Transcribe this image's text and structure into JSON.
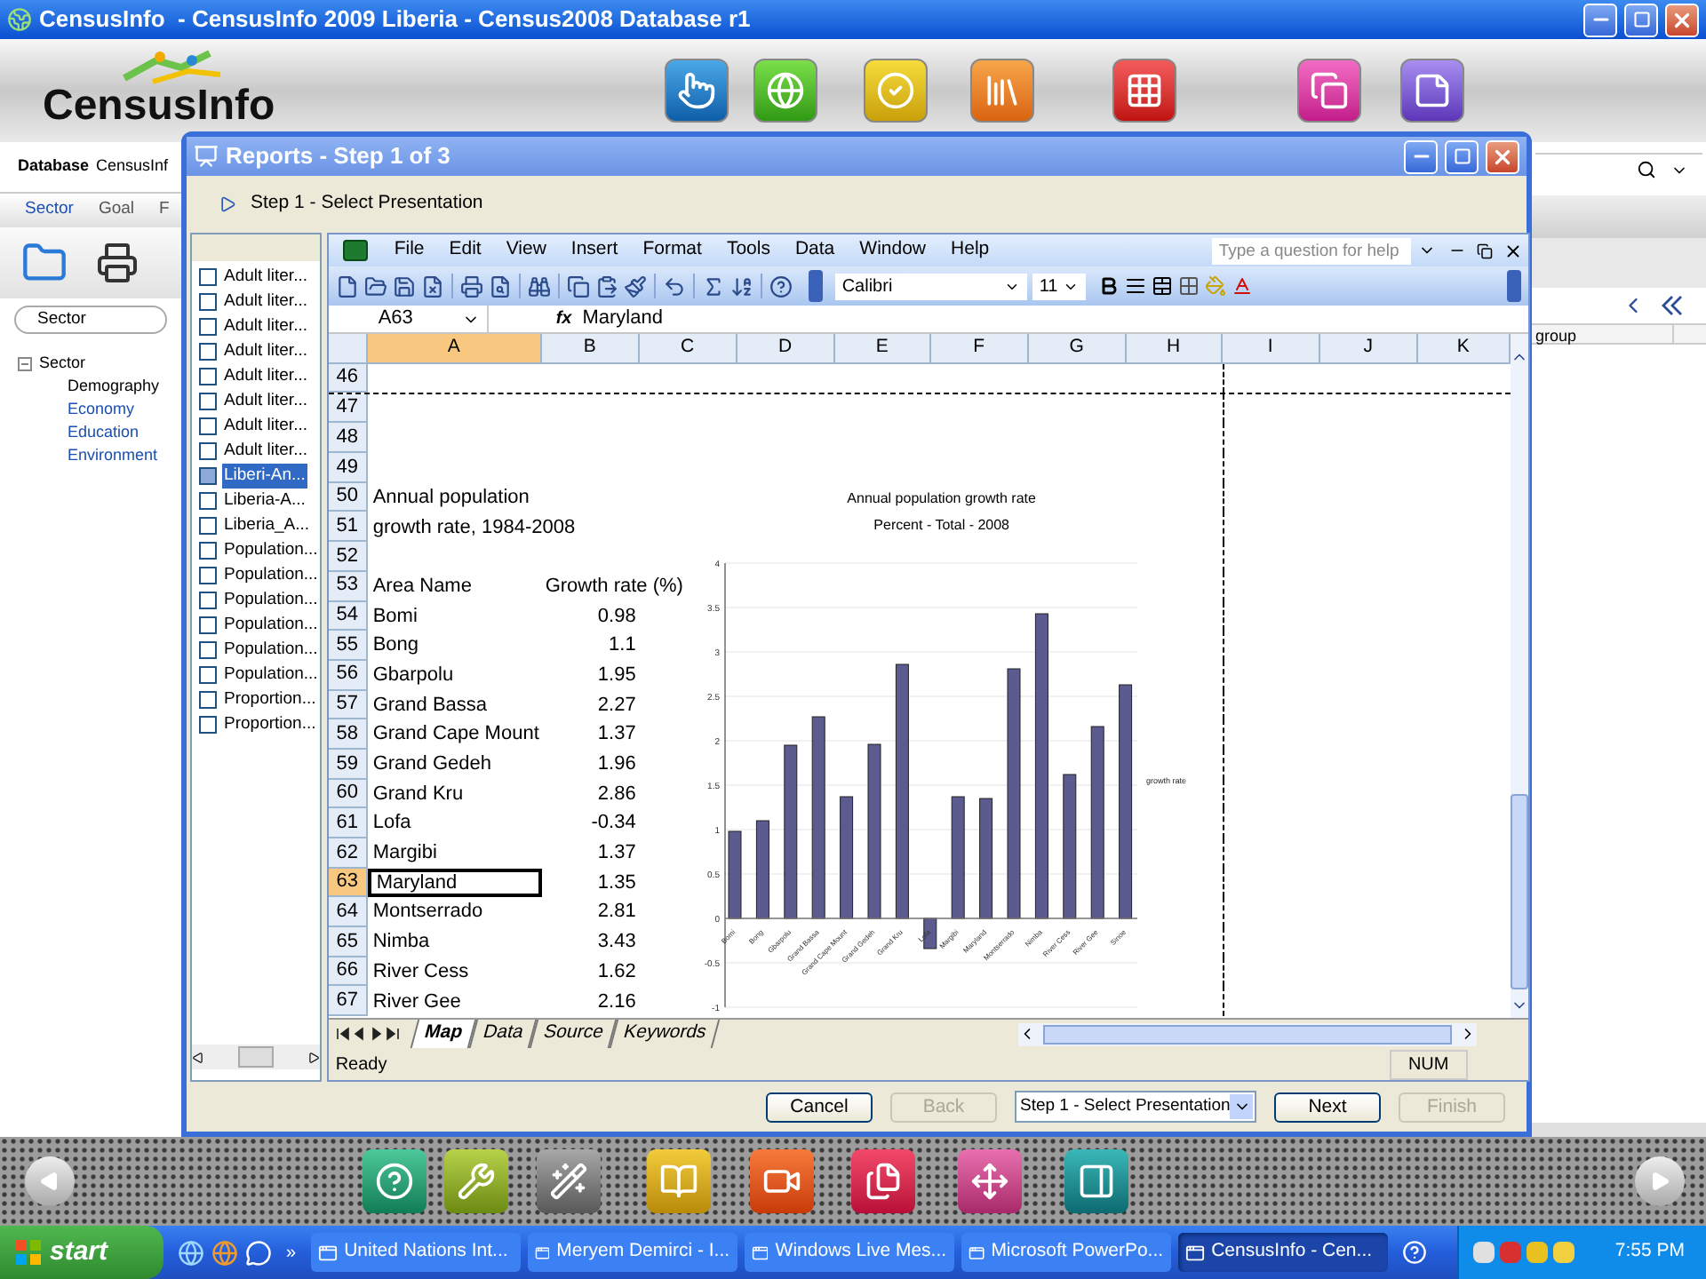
{
  "app": {
    "title": "CensusInfo  - CensusInfo 2009 Liberia - Census2008 Database r1",
    "logo": "CensusInfo",
    "database_label": "Database",
    "database_value": "CensusInf",
    "tabs": [
      {
        "label": "Sector",
        "selected": true
      },
      {
        "label": "Goal",
        "selected": false
      },
      {
        "label": "F",
        "selected": false
      }
    ],
    "selector": "Sector",
    "tree": [
      {
        "label": "Sector",
        "expanded": true,
        "children": [
          {
            "label": "Demography",
            "selected": true
          },
          {
            "label": "Economy",
            "selected": false
          },
          {
            "label": "Education",
            "selected": false
          },
          {
            "label": "Environment",
            "selected": false
          }
        ]
      }
    ],
    "column_header": "group"
  },
  "dialog": {
    "title": "Reports - Step 1 of 3",
    "step": "Step 1 - Select Presentation",
    "items": [
      {
        "label": "Adult liter...",
        "checked": false,
        "selected": false
      },
      {
        "label": "Adult liter...",
        "checked": false,
        "selected": false
      },
      {
        "label": "Adult liter...",
        "checked": false,
        "selected": false
      },
      {
        "label": "Adult liter...",
        "checked": false,
        "selected": false
      },
      {
        "label": "Adult liter...",
        "checked": false,
        "selected": false
      },
      {
        "label": "Adult liter...",
        "checked": false,
        "selected": false
      },
      {
        "label": "Adult liter...",
        "checked": false,
        "selected": false
      },
      {
        "label": "Adult liter...",
        "checked": false,
        "selected": false
      },
      {
        "label": "Liberi-An...",
        "checked": false,
        "selected": true
      },
      {
        "label": "Liberia-A...",
        "checked": false,
        "selected": false
      },
      {
        "label": "Liberia_A...",
        "checked": false,
        "selected": false
      },
      {
        "label": "Population...",
        "checked": false,
        "selected": false
      },
      {
        "label": "Population...",
        "checked": false,
        "selected": false
      },
      {
        "label": "Population...",
        "checked": false,
        "selected": false
      },
      {
        "label": "Population...",
        "checked": false,
        "selected": false
      },
      {
        "label": "Population...",
        "checked": false,
        "selected": false
      },
      {
        "label": "Population...",
        "checked": false,
        "selected": false
      },
      {
        "label": "Proportion...",
        "checked": false,
        "selected": false
      },
      {
        "label": "Proportion...",
        "checked": false,
        "selected": false
      }
    ],
    "sheet": {
      "menu": [
        "File",
        "Edit",
        "View",
        "Insert",
        "Format",
        "Tools",
        "Data",
        "Window",
        "Help"
      ],
      "help_placeholder": "Type a question for help",
      "font": "Calibri",
      "font_size": "11",
      "name_box": "A63",
      "fx": "fx",
      "formula": "Maryland",
      "columns": [
        {
          "label": "A",
          "selected": true
        },
        {
          "label": "B",
          "selected": false
        },
        {
          "label": "C",
          "selected": false
        },
        {
          "label": "D",
          "selected": false
        },
        {
          "label": "E",
          "selected": false
        },
        {
          "label": "F",
          "selected": false
        },
        {
          "label": "G",
          "selected": false
        },
        {
          "label": "H",
          "selected": false
        },
        {
          "label": "I",
          "selected": false
        },
        {
          "label": "J",
          "selected": false
        },
        {
          "label": "K",
          "selected": false
        }
      ],
      "rows": [
        {
          "number": "46",
          "kind": "blank",
          "selected": false
        },
        {
          "number": "47",
          "kind": "blank",
          "selected": false
        },
        {
          "number": "48",
          "kind": "blank",
          "selected": false
        },
        {
          "number": "49",
          "kind": "blank",
          "selected": false
        },
        {
          "number": "50",
          "kind": "title",
          "a": "Annual population",
          "selected": false
        },
        {
          "number": "51",
          "kind": "title",
          "a": "growth rate, 1984-2008",
          "selected": false
        },
        {
          "number": "52",
          "kind": "blank",
          "selected": false
        },
        {
          "number": "53",
          "kind": "header",
          "a": "Area Name",
          "b": "Growth rate (%)",
          "selected": false
        },
        {
          "number": "54",
          "kind": "data",
          "a": "Bomi",
          "b": "0.98",
          "selected": false
        },
        {
          "number": "55",
          "kind": "data",
          "a": "Bong",
          "b": "1.1",
          "selected": false
        },
        {
          "number": "56",
          "kind": "data",
          "a": "Gbarpolu",
          "b": "1.95",
          "selected": false
        },
        {
          "number": "57",
          "kind": "data",
          "a": "Grand Bassa",
          "b": "2.27",
          "selected": false
        },
        {
          "number": "58",
          "kind": "data",
          "a": "Grand Cape Mount",
          "b": "1.37",
          "selected": false
        },
        {
          "number": "59",
          "kind": "data",
          "a": "Grand Gedeh",
          "b": "1.96",
          "selected": false
        },
        {
          "number": "60",
          "kind": "data",
          "a": "Grand Kru",
          "b": "2.86",
          "selected": false
        },
        {
          "number": "61",
          "kind": "data",
          "a": "Lofa",
          "b": "-0.34",
          "selected": false
        },
        {
          "number": "62",
          "kind": "data",
          "a": "Margibi",
          "b": "1.37",
          "selected": false
        },
        {
          "number": "63",
          "kind": "data",
          "a": "Maryland",
          "b": "1.35",
          "selected": true
        },
        {
          "number": "64",
          "kind": "data",
          "a": "Montserrado",
          "b": "2.81",
          "selected": false
        },
        {
          "number": "65",
          "kind": "data",
          "a": "Nimba",
          "b": "3.43",
          "selected": false
        },
        {
          "number": "66",
          "kind": "data",
          "a": "River Cess",
          "b": "1.62",
          "selected": false
        },
        {
          "number": "67",
          "kind": "data",
          "a": "River Gee",
          "b": "2.16",
          "selected": false
        }
      ],
      "chart_subtitle": "Percent - Total - 2008",
      "chart_data": {
        "type": "bar",
        "title": "Annual population growth rate",
        "grid": true,
        "categories": [
          "Bomi",
          "Bong",
          "Gbarpolu",
          "Grand Bassa",
          "Grand Cape Mount",
          "Grand Gedeh",
          "Grand Kru",
          "Lofa",
          "Margibi",
          "Maryland",
          "Montserrado",
          "Nimba",
          "River Cess",
          "River Gee",
          "Sinoe"
        ],
        "series": [
          {
            "name": "growth rate",
            "color": "#5b5b8f",
            "values": [
              0.98,
              1.1,
              1.95,
              2.27,
              1.37,
              1.96,
              2.86,
              -0.34,
              1.37,
              1.35,
              2.81,
              3.43,
              1.62,
              2.16,
              2.63
            ]
          }
        ],
        "ylim": [
          -1,
          4
        ],
        "yticks": [
          -1,
          -0.5,
          0,
          0.5,
          1,
          1.5,
          2,
          2.5,
          3,
          3.5,
          4
        ]
      },
      "sheet_tabs": [
        {
          "label": "Map",
          "selected": true
        },
        {
          "label": "Data",
          "selected": false
        },
        {
          "label": "Source",
          "selected": false
        },
        {
          "label": "Keywords",
          "selected": false
        }
      ],
      "status": "Ready",
      "num": "NUM"
    },
    "footer": [
      {
        "kind": "button",
        "label": "Cancel",
        "disabled": false
      },
      {
        "kind": "button",
        "label": "Back",
        "disabled": true
      },
      {
        "kind": "select",
        "label": "Step 1 - Select Presentation",
        "disabled": false
      },
      {
        "kind": "button",
        "label": "Next",
        "disabled": false
      },
      {
        "kind": "button",
        "label": "Finish",
        "disabled": true
      }
    ]
  },
  "taskbar": {
    "start": "start",
    "more": "»",
    "tasks": [
      {
        "label": "United Nations Int...",
        "selected": false
      },
      {
        "label": "Meryem Demirci - I...",
        "selected": false
      },
      {
        "label": "Windows Live Mes...",
        "selected": false
      },
      {
        "label": "Microsoft PowerPo...",
        "selected": false
      },
      {
        "label": "CensusInfo - Cen...",
        "selected": true
      }
    ],
    "time": "7:55 PM"
  }
}
